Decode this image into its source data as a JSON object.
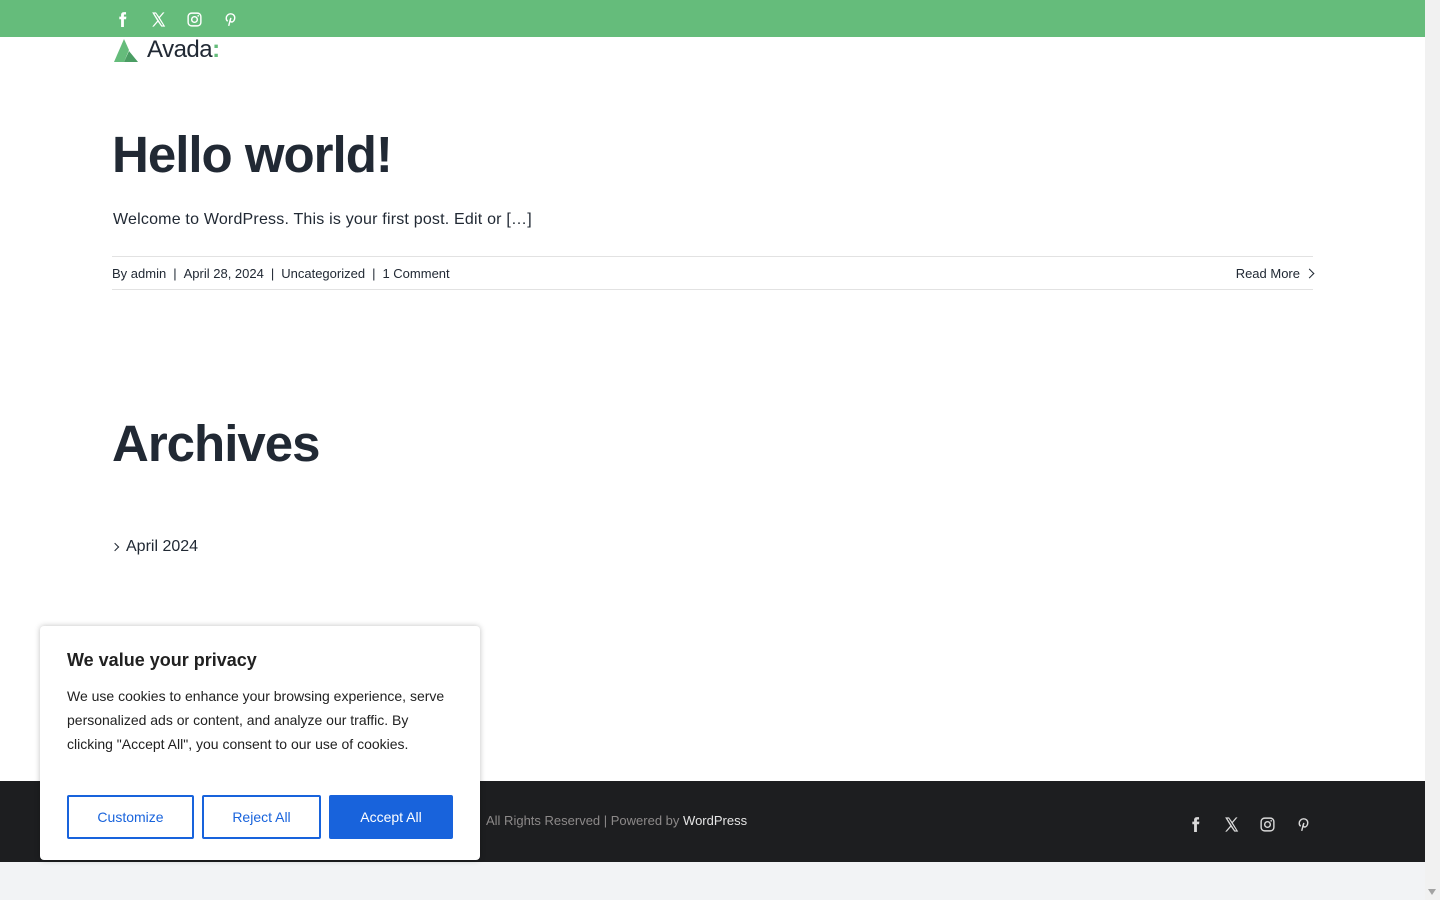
{
  "topbar": {
    "bg_color": "#65bc7b",
    "social_icons": [
      "facebook-icon",
      "x-icon",
      "instagram-icon",
      "pinterest-icon"
    ]
  },
  "logo": {
    "name": "Avada",
    "accent": ":"
  },
  "post": {
    "title": "Hello world!",
    "excerpt": "Welcome to WordPress. This is your first post. Edit or […]",
    "meta": {
      "by_prefix": "By",
      "author": "admin",
      "date": "April 28, 2024",
      "category": "Uncategorized",
      "comments": "1 Comment"
    },
    "read_more": "Read More"
  },
  "archives": {
    "title": "Archives",
    "items": [
      {
        "label": "April 2024"
      }
    ]
  },
  "footer": {
    "copyright_text": "All Rights Reserved | Powered by",
    "powered_by_link": "WordPress",
    "social_icons": [
      "facebook-icon",
      "x-icon",
      "instagram-icon",
      "pinterest-icon"
    ]
  },
  "cookie": {
    "title": "We value your privacy",
    "body": "We use cookies to enhance your browsing experience, serve personalized ads or content, and analyze our traffic. By clicking \"Accept All\", you consent to our use of cookies.",
    "customize": "Customize",
    "reject": "Reject All",
    "accept": "Accept All",
    "accent_color": "#1863dc"
  }
}
